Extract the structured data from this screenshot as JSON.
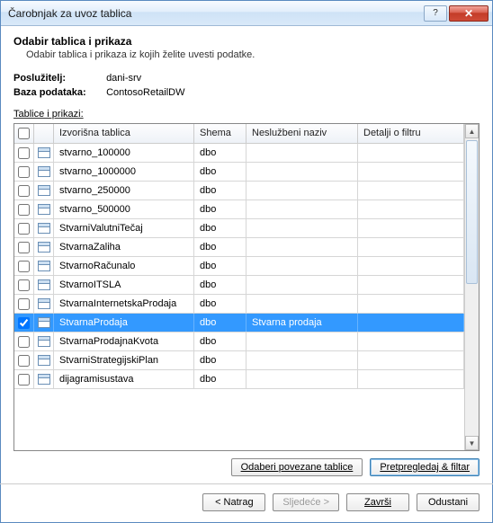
{
  "window": {
    "title": "Čarobnjak za uvoz tablica"
  },
  "header": {
    "heading": "Odabir tablica i prikaza",
    "subheading": "Odabir tablica i prikaza iz kojih želite uvesti podatke."
  },
  "meta": {
    "server_label": "Poslužitelj:",
    "server_value": "dani-srv",
    "database_label": "Baza podataka:",
    "database_value": "ContosoRetailDW",
    "tables_label_pre": "T",
    "tables_label_rest": "ablice i prikazi:"
  },
  "columns": {
    "source": "Izvorišna tablica",
    "schema": "Shema",
    "friendly": "Neslužbeni naziv",
    "filter": "Detalji o filtru"
  },
  "rows": [
    {
      "checked": false,
      "name": "stvarno_100000",
      "schema": "dbo",
      "friendly": "",
      "selected": false
    },
    {
      "checked": false,
      "name": "stvarno_1000000",
      "schema": "dbo",
      "friendly": "",
      "selected": false
    },
    {
      "checked": false,
      "name": "stvarno_250000",
      "schema": "dbo",
      "friendly": "",
      "selected": false
    },
    {
      "checked": false,
      "name": "stvarno_500000",
      "schema": "dbo",
      "friendly": "",
      "selected": false
    },
    {
      "checked": false,
      "name": "StvarniValutniTečaj",
      "schema": "dbo",
      "friendly": "",
      "selected": false
    },
    {
      "checked": false,
      "name": "StvarnaZaliha",
      "schema": "dbo",
      "friendly": "",
      "selected": false
    },
    {
      "checked": false,
      "name": "StvarnoRačunalo",
      "schema": "dbo",
      "friendly": "",
      "selected": false
    },
    {
      "checked": false,
      "name": "StvarnoITSLA",
      "schema": "dbo",
      "friendly": "",
      "selected": false
    },
    {
      "checked": false,
      "name": "StvarnaInternetskaProdaja",
      "schema": "dbo",
      "friendly": "",
      "selected": false
    },
    {
      "checked": true,
      "name": "StvarnaProdaja",
      "schema": "dbo",
      "friendly": "Stvarna prodaja",
      "selected": true
    },
    {
      "checked": false,
      "name": "StvarnaProdajnaKvota",
      "schema": "dbo",
      "friendly": "",
      "selected": false
    },
    {
      "checked": false,
      "name": "StvarniStrategijskiPlan",
      "schema": "dbo",
      "friendly": "",
      "selected": false
    },
    {
      "checked": false,
      "name": "dijagramisustava",
      "schema": "dbo",
      "friendly": "",
      "selected": false
    }
  ],
  "mid_buttons": {
    "select_related": "Odaberi povezane tablice",
    "preview_filter": "Pretpregledaj & filtar"
  },
  "footer": {
    "back": "< Natrag",
    "next": "Sljedeće >",
    "finish": "Završi",
    "cancel": "Odustani"
  }
}
